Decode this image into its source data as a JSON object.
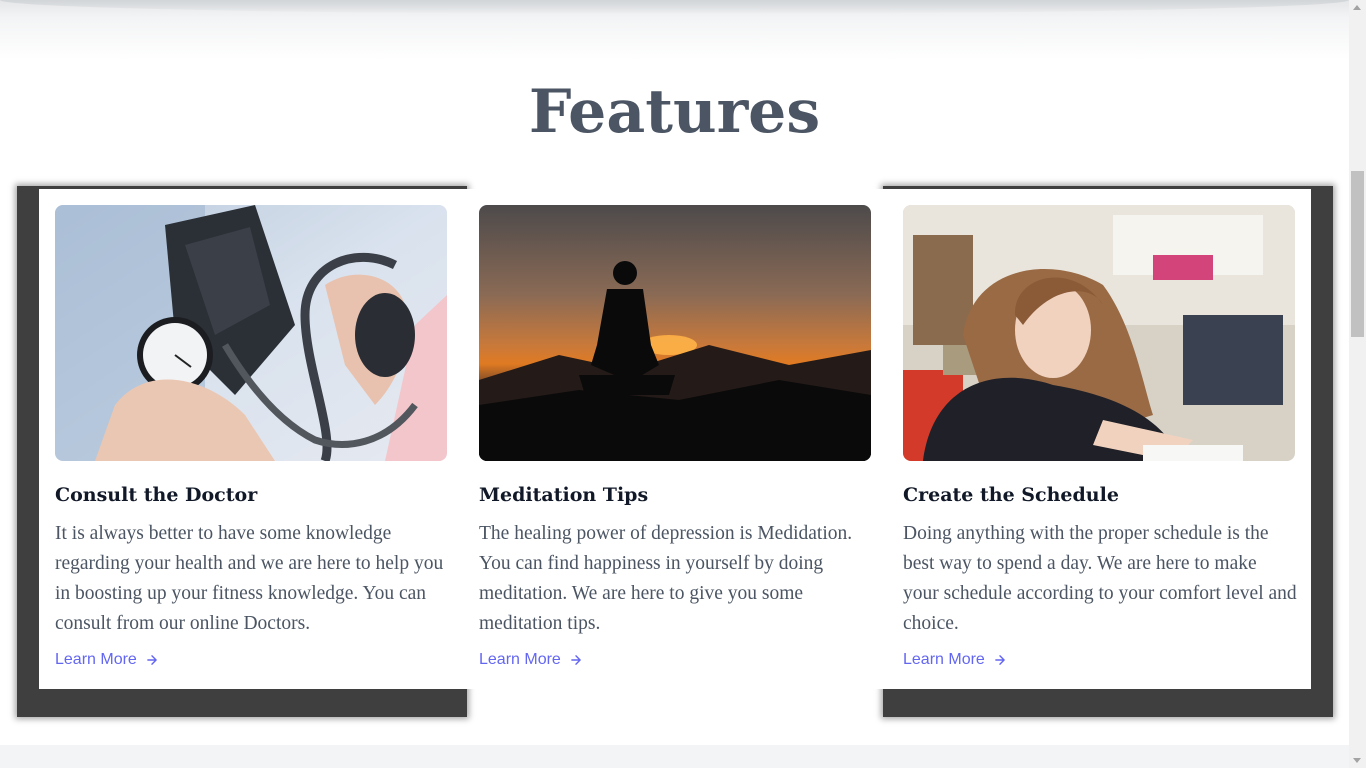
{
  "section": {
    "title": "Features"
  },
  "cards": [
    {
      "title": "Consult the Doctor",
      "text": "It is always better to have some knowledge regarding your health and we are here to help you in boosting up your fitness knowledge. You can consult from our online Doctors.",
      "link_label": "Learn More",
      "image": "blood-pressure-check-photo"
    },
    {
      "title": "Meditation Tips",
      "text": "The healing power of depression is Medidation. You can find happiness in yourself by doing meditation. We are here to give you some meditation tips.",
      "link_label": "Learn More",
      "image": "meditation-sunset-photo"
    },
    {
      "title": "Create the Schedule",
      "text": "Doing anything with the proper schedule is the best way to spend a day. We are here to make your schedule according to your comfort level and choice.",
      "link_label": "Learn More",
      "image": "girl-writing-photo"
    }
  ],
  "colors": {
    "accent": "#6366f1",
    "title": "#4b5563",
    "card_title": "#111827",
    "hover_shadow": "#3f3f3f"
  }
}
